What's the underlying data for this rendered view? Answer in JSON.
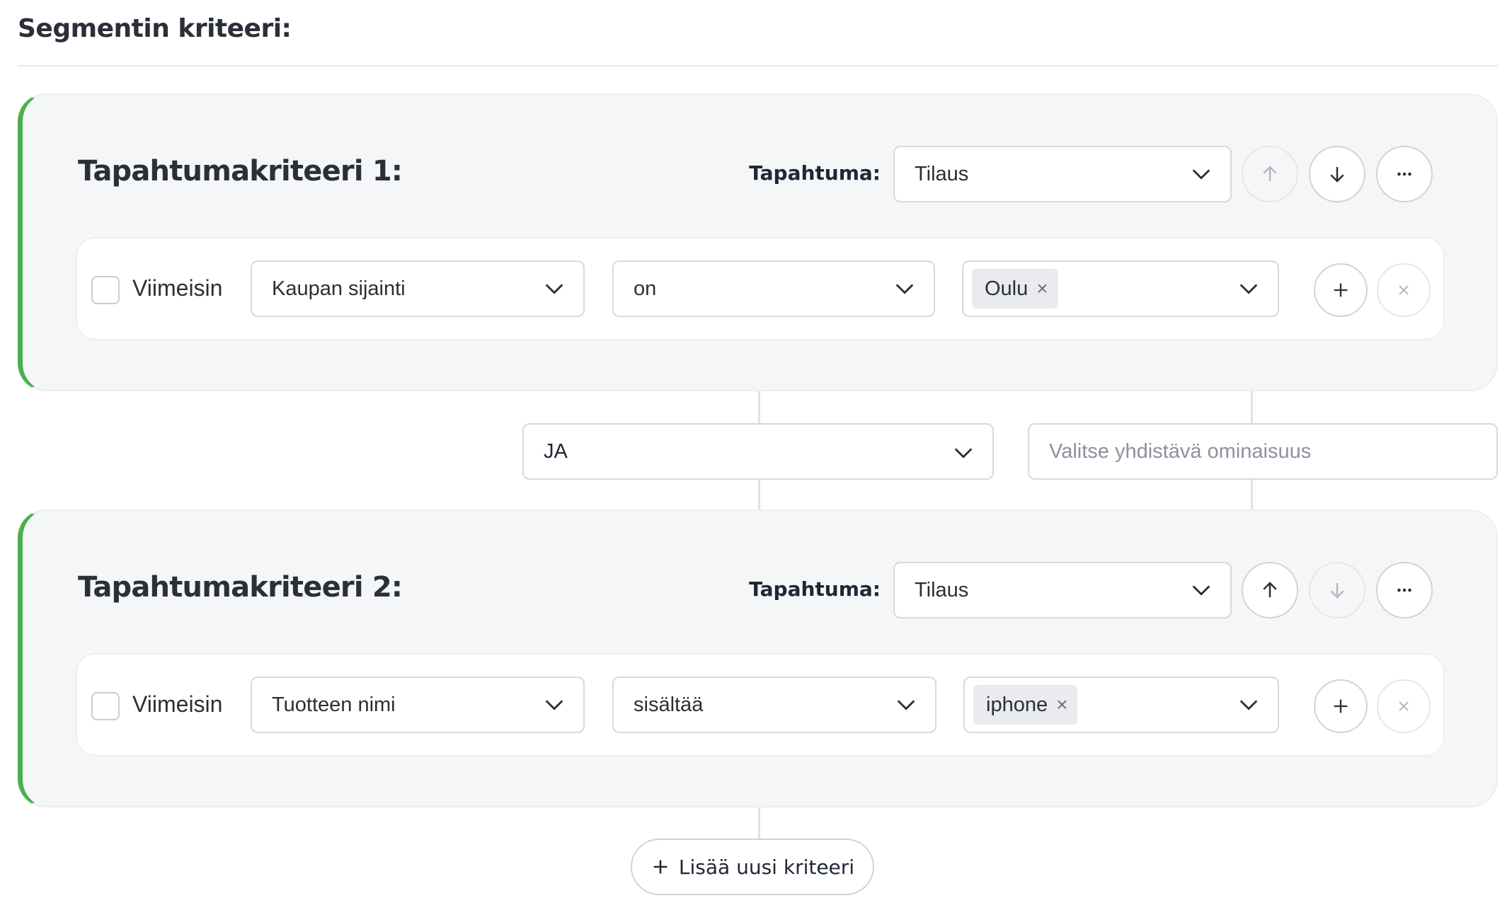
{
  "page": {
    "heading": "Segmentin kriteeri:",
    "add_button_label": "Lisää uusi kriteeri"
  },
  "criteria": [
    {
      "title": "Tapahtumakriteeri 1:",
      "event_label": "Tapahtuma:",
      "event_value": "Tilaus",
      "move_up_disabled": true,
      "move_down_disabled": false,
      "condition": {
        "latest_label": "Viimeisin",
        "latest_checked": false,
        "property": "Kaupan sijainti",
        "operator": "on",
        "values": [
          "Oulu"
        ]
      }
    },
    {
      "title": "Tapahtumakriteeri 2:",
      "event_label": "Tapahtuma:",
      "event_value": "Tilaus",
      "move_up_disabled": false,
      "move_down_disabled": true,
      "condition": {
        "latest_label": "Viimeisin",
        "latest_checked": false,
        "property": "Tuotteen nimi",
        "operator": "sisältää",
        "values": [
          "iphone"
        ]
      }
    }
  ],
  "combiner": {
    "logic": "JA",
    "property_placeholder": "Valitse yhdistävä ominaisuus"
  },
  "icons": {
    "move_up": "arrow-up-icon",
    "move_down": "arrow-down-icon",
    "more": "more-horizontal-icon",
    "add": "plus-icon",
    "remove": "close-icon",
    "dropdown": "chevron-down-icon",
    "tag_remove": "close-icon"
  },
  "colors": {
    "accent_green": "#4caf50",
    "card_bg": "#f5f6f8",
    "border": "#d6d9de",
    "placeholder": "#8b929c"
  }
}
